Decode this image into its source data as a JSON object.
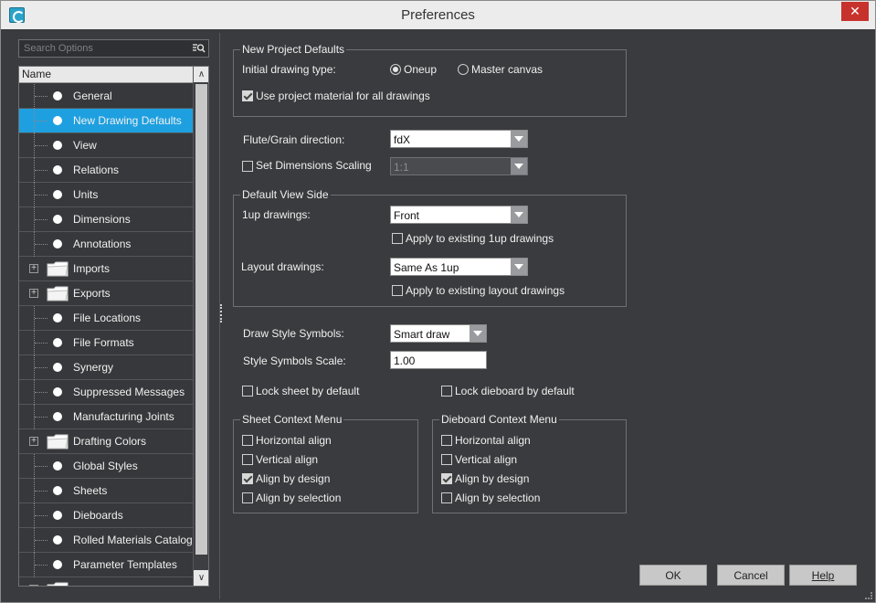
{
  "window": {
    "title": "Preferences",
    "close_glyph": "✕"
  },
  "left": {
    "search_placeholder": "Search Options",
    "tree_header": "Name",
    "items": [
      {
        "label": "General",
        "type": "leaf",
        "selected": false
      },
      {
        "label": "New Drawing Defaults",
        "type": "leaf",
        "selected": true
      },
      {
        "label": "View",
        "type": "leaf",
        "selected": false
      },
      {
        "label": "Relations",
        "type": "leaf",
        "selected": false
      },
      {
        "label": "Units",
        "type": "leaf",
        "selected": false
      },
      {
        "label": "Dimensions",
        "type": "leaf",
        "selected": false
      },
      {
        "label": "Annotations",
        "type": "leaf",
        "selected": false
      },
      {
        "label": "Imports",
        "type": "folder",
        "selected": false
      },
      {
        "label": "Exports",
        "type": "folder",
        "selected": false
      },
      {
        "label": "File Locations",
        "type": "leaf",
        "selected": false
      },
      {
        "label": "File Formats",
        "type": "leaf",
        "selected": false
      },
      {
        "label": "Synergy",
        "type": "leaf",
        "selected": false
      },
      {
        "label": "Suppressed Messages",
        "type": "leaf",
        "selected": false
      },
      {
        "label": "Manufacturing Joints",
        "type": "leaf",
        "selected": false
      },
      {
        "label": "Drafting Colors",
        "type": "folder",
        "selected": false
      },
      {
        "label": "Global Styles",
        "type": "leaf",
        "selected": false
      },
      {
        "label": "Sheets",
        "type": "leaf",
        "selected": false
      },
      {
        "label": "Dieboards",
        "type": "leaf",
        "selected": false
      },
      {
        "label": "Rolled Materials Catalog",
        "type": "leaf",
        "selected": false
      },
      {
        "label": "Parameter Templates",
        "type": "leaf",
        "selected": false
      },
      {
        "label": "",
        "type": "folder",
        "selected": false
      }
    ],
    "expander_glyph": "+",
    "scroll_up_glyph": "∧",
    "scroll_down_glyph": "∨"
  },
  "project": {
    "legend": "New Project Defaults",
    "initial_type_label": "Initial drawing type:",
    "oneup_label": "Oneup",
    "master_label": "Master canvas",
    "oneup_checked": true,
    "use_material_label": "Use project material for all drawings",
    "use_material_checked": true
  },
  "flute": {
    "label": "Flute/Grain direction:",
    "value": "fdX"
  },
  "scaling": {
    "label": "Set Dimensions Scaling",
    "checked": false,
    "value": "1:1"
  },
  "viewside": {
    "legend": "Default View Side",
    "oneup_label": "1up drawings:",
    "oneup_value": "Front",
    "apply_oneup_label": "Apply to existing 1up drawings",
    "layout_label": "Layout drawings:",
    "layout_value": "Same As 1up",
    "apply_layout_label": "Apply to existing layout drawings"
  },
  "symbols": {
    "draw_label": "Draw Style Symbols:",
    "draw_value": "Smart draw",
    "scale_label": "Style Symbols Scale:",
    "scale_value": "1.00"
  },
  "locks": {
    "sheet_label": "Lock sheet by default",
    "dieboard_label": "Lock dieboard by default"
  },
  "sheet_menu": {
    "legend": "Sheet Context Menu",
    "items": [
      "Horizontal align",
      "Vertical align",
      "Align by design",
      "Align by selection"
    ],
    "checked": [
      false,
      false,
      true,
      false
    ]
  },
  "dieboard_menu": {
    "legend": "Dieboard Context Menu",
    "items": [
      "Horizontal align",
      "Vertical align",
      "Align by design",
      "Align by selection"
    ],
    "checked": [
      false,
      false,
      true,
      false
    ]
  },
  "buttons": {
    "ok": "OK",
    "cancel": "Cancel",
    "help": "Help"
  },
  "colors": {
    "selection": "#1ea0e0",
    "close": "#c7332c"
  }
}
